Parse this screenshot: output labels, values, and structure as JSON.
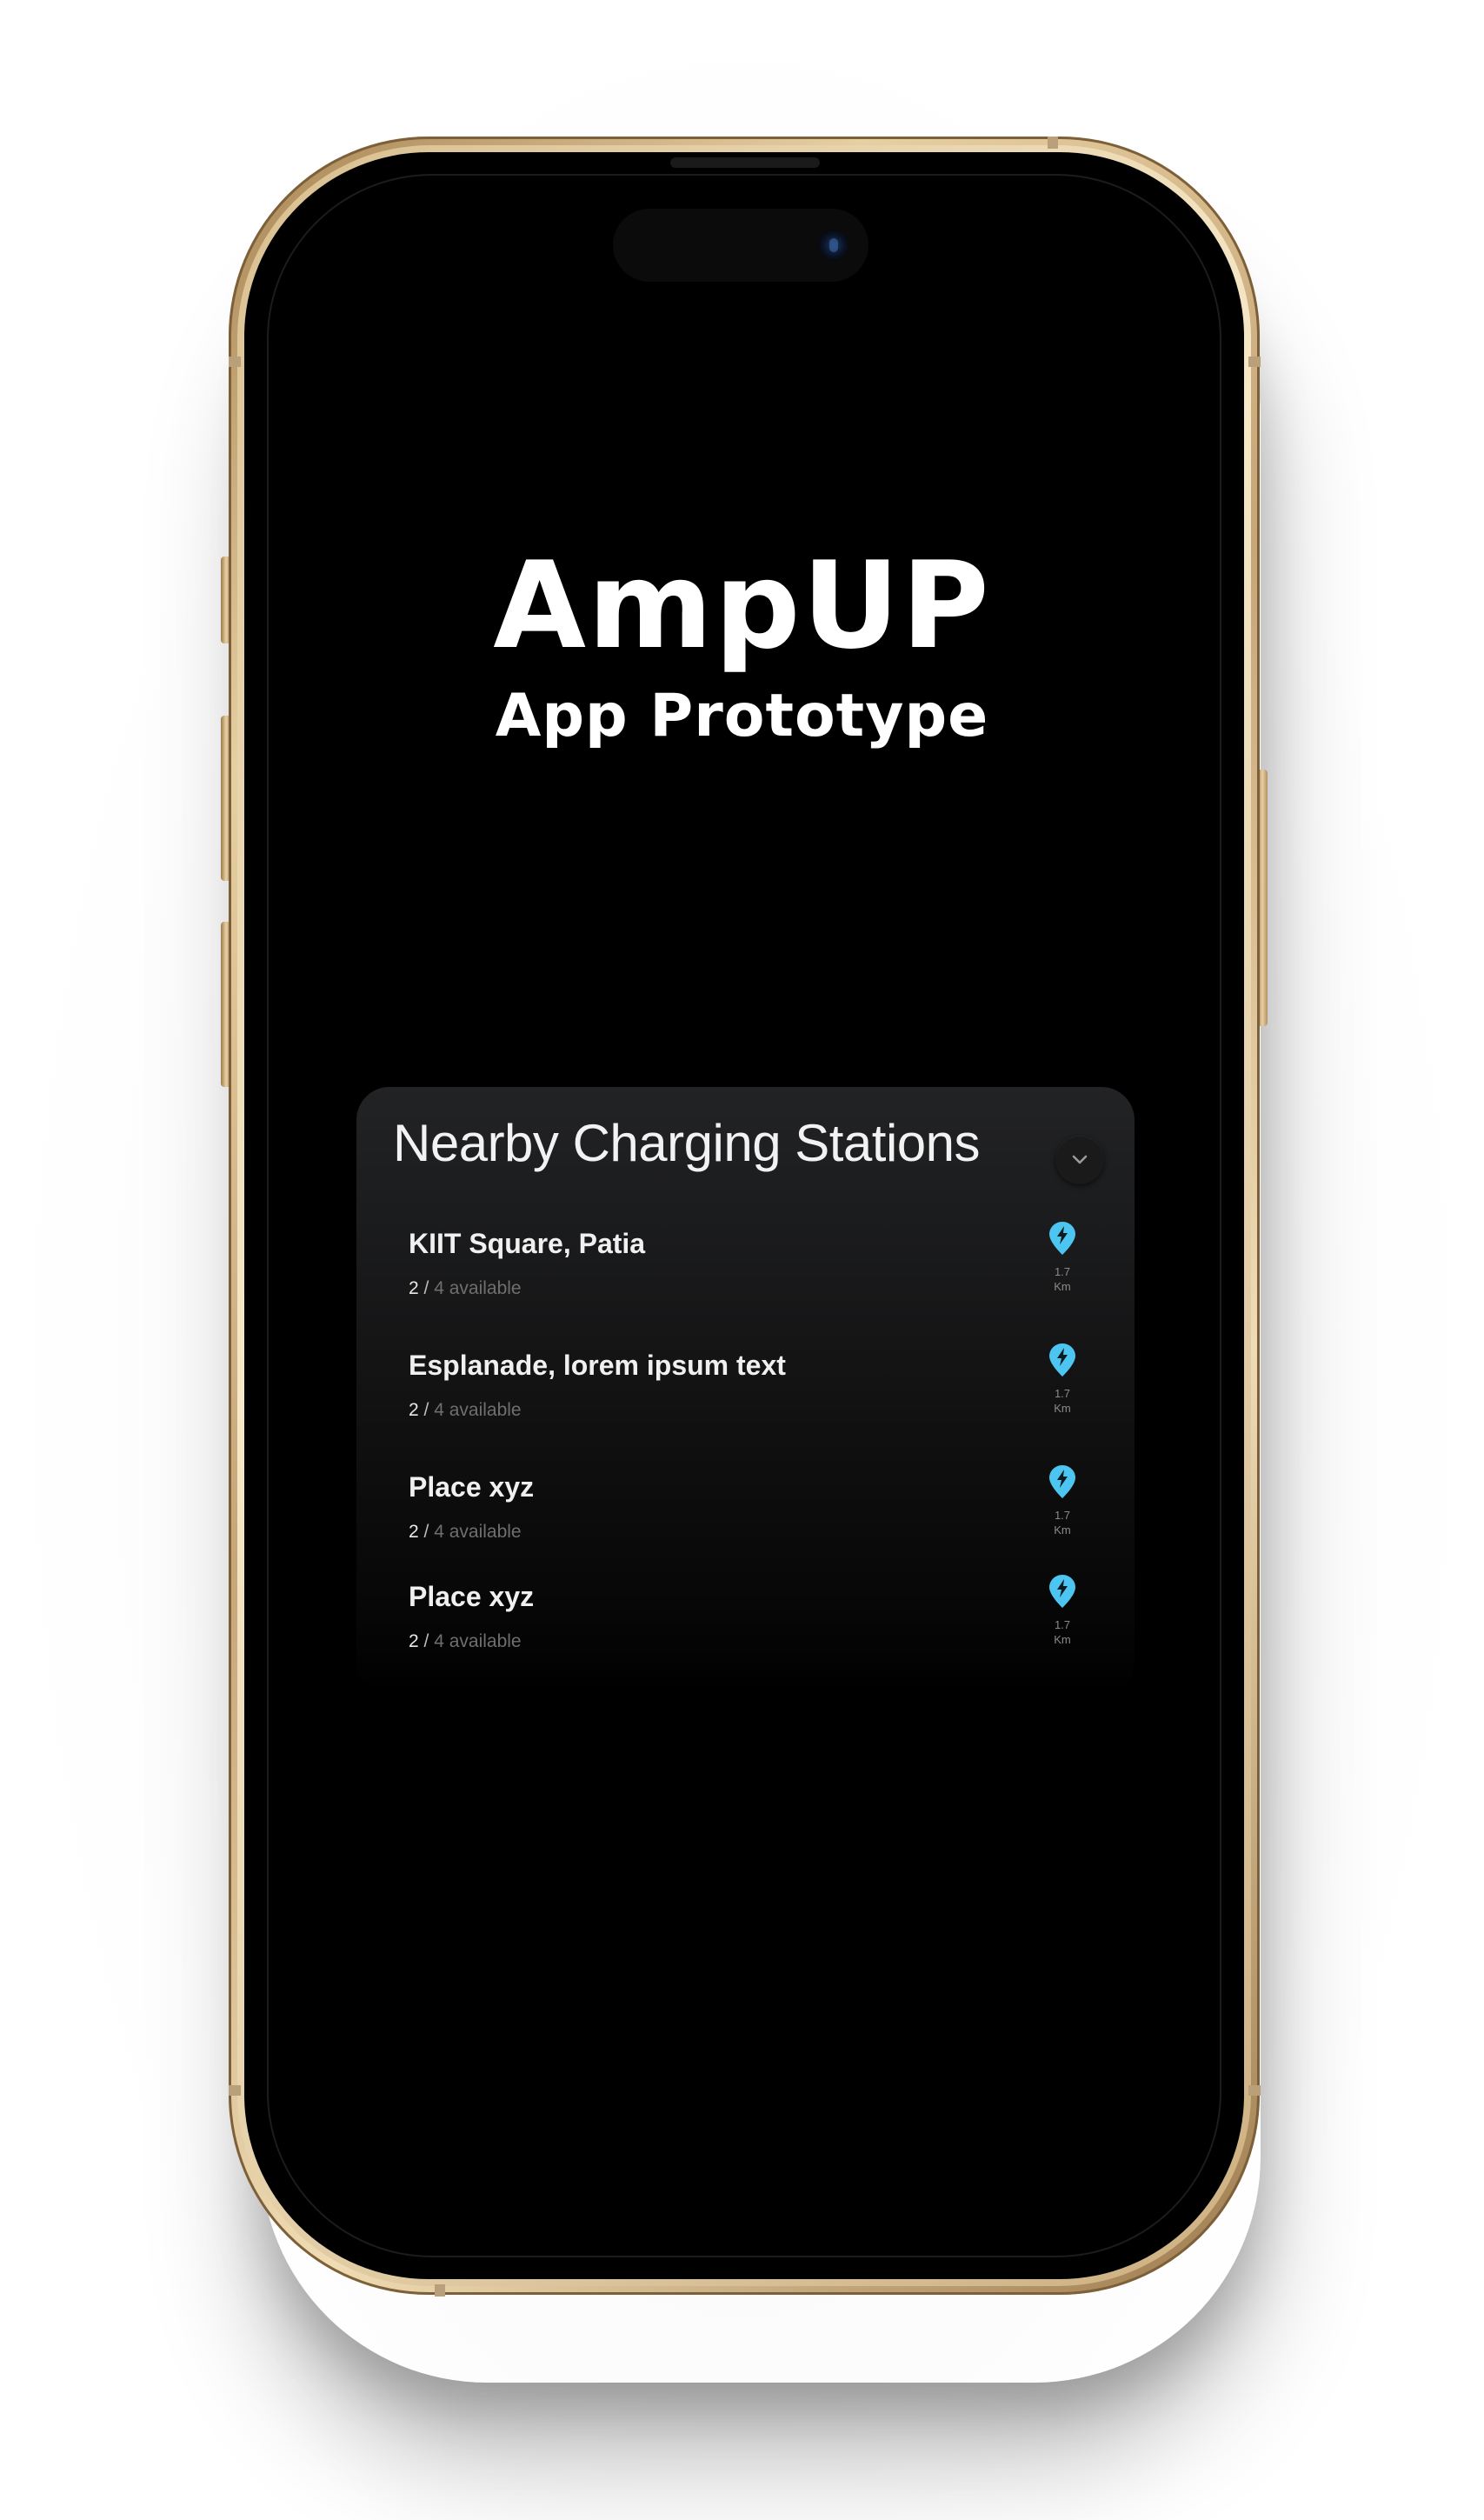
{
  "app": {
    "title": "AmpUP",
    "subtitle": "App Prototype"
  },
  "card": {
    "title": "Nearby Charging Stations",
    "collapse_icon": "chevron-down-icon"
  },
  "stations": [
    {
      "name": "KIIT Square, Patia",
      "available": "2",
      "separator": " / ",
      "total_label": "4 available",
      "distance": "1.7",
      "unit": "Km"
    },
    {
      "name": "Esplanade, lorem ipsum text",
      "available": "2",
      "separator": " / ",
      "total_label": "4 available",
      "distance": "1.7",
      "unit": "Km"
    },
    {
      "name": "Place xyz",
      "available": "2",
      "separator": " / ",
      "total_label": "4 available",
      "distance": "1.7",
      "unit": "Km"
    },
    {
      "name": "Place xyz",
      "available": "2",
      "separator": " / ",
      "total_label": "4 available",
      "distance": "1.7",
      "unit": "Km"
    }
  ],
  "colors": {
    "accent": "#4cc6f0",
    "frame": "#d9bf90",
    "screen": "#000000"
  }
}
